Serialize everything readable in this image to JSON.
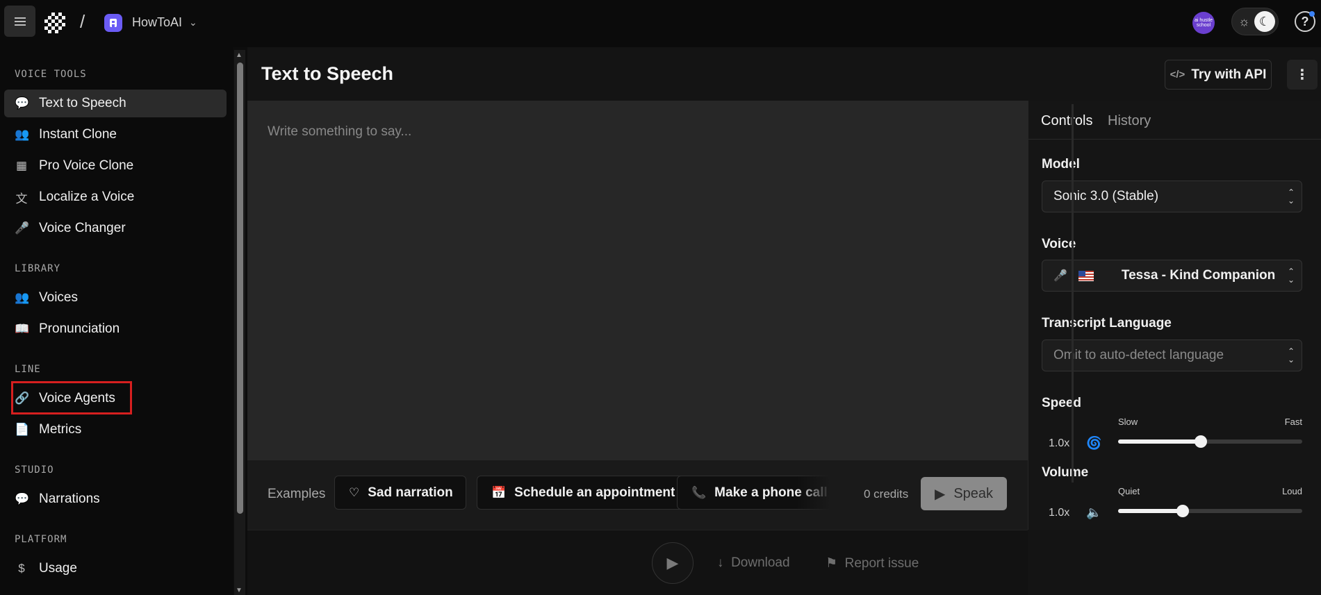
{
  "topbar": {
    "org_name": "HowToAI",
    "avatar_text": "ai hustle school",
    "separator": "/"
  },
  "sidebar": {
    "sections": [
      {
        "title": "VOICE TOOLS",
        "items": [
          {
            "label": "Text to Speech",
            "icon": "chat-bubbles-icon",
            "active": true
          },
          {
            "label": "Instant Clone",
            "icon": "users-icon"
          },
          {
            "label": "Pro Voice Clone",
            "icon": "chip-icon"
          },
          {
            "label": "Localize a Voice",
            "icon": "translate-icon"
          },
          {
            "label": "Voice Changer",
            "icon": "microphone-icon"
          }
        ]
      },
      {
        "title": "LIBRARY",
        "items": [
          {
            "label": "Voices",
            "icon": "users-icon"
          },
          {
            "label": "Pronunciation",
            "icon": "book-icon"
          }
        ]
      },
      {
        "title": "LINE",
        "items": [
          {
            "label": "Voice Agents",
            "icon": "link-icon",
            "highlighted": true
          },
          {
            "label": "Metrics",
            "icon": "document-chart-icon"
          }
        ]
      },
      {
        "title": "STUDIO",
        "items": [
          {
            "label": "Narrations",
            "icon": "chat-bubbles-icon"
          }
        ]
      },
      {
        "title": "PLATFORM",
        "items": [
          {
            "label": "Usage",
            "icon": "dollar-doc-icon"
          }
        ]
      }
    ]
  },
  "main": {
    "title": "Text to Speech",
    "api_button": "Try with API",
    "editor_placeholder": "Write something to say...",
    "examples_label": "Examples",
    "examples": [
      {
        "label": "Sad narration",
        "icon": "heart-icon"
      },
      {
        "label": "Schedule an appointment",
        "icon": "calendar-icon"
      },
      {
        "label": "Make a phone call",
        "icon": "phone-icon"
      }
    ],
    "credits": "0 credits",
    "speak_button": "Speak",
    "download": "Download",
    "report": "Report issue"
  },
  "panel": {
    "tabs": [
      "Controls",
      "History"
    ],
    "model_label": "Model",
    "model_value": "Sonic 3.0 (Stable)",
    "voice_label": "Voice",
    "voice_value": "Tessa - Kind Companion",
    "language_label": "Transcript Language",
    "language_placeholder": "Omit to auto-detect language",
    "speed": {
      "label": "Speed",
      "value": "1.0x",
      "min_label": "Slow",
      "max_label": "Fast",
      "level": 0.45
    },
    "volume": {
      "label": "Volume",
      "value": "1.0x",
      "min_label": "Quiet",
      "max_label": "Loud",
      "level": 0.35
    }
  },
  "colors": {
    "highlight_box": "#d61f1f",
    "org_icon": "#6b5cf5",
    "avatar": "#6a3fcf",
    "notification_dot": "#3b82f6"
  }
}
